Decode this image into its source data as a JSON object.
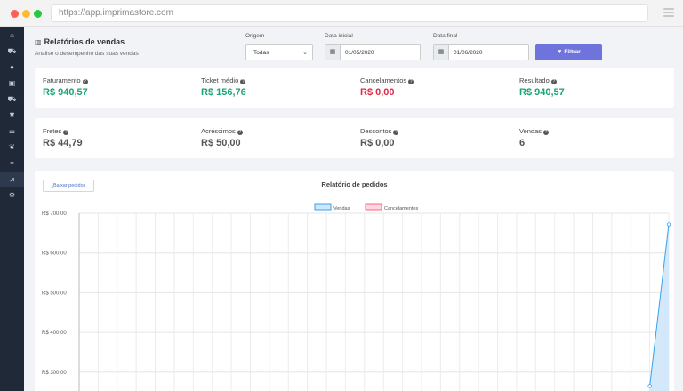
{
  "browser": {
    "url": "https://app.imprimastore.com"
  },
  "sidebar": {
    "items": [
      {
        "icon": "home-icon",
        "glyph": "⌂"
      },
      {
        "icon": "cart-icon",
        "glyph": "⛟"
      },
      {
        "icon": "user-icon",
        "glyph": "●"
      },
      {
        "icon": "box-icon",
        "glyph": "▣"
      },
      {
        "icon": "truck-icon",
        "glyph": "⛟"
      },
      {
        "icon": "tools-icon",
        "glyph": "✖"
      },
      {
        "icon": "sitemap-icon",
        "glyph": "⚏"
      },
      {
        "icon": "leaf-icon",
        "glyph": "❦"
      },
      {
        "icon": "plug-icon",
        "glyph": "ǂ"
      },
      {
        "icon": "chart-line-icon",
        "glyph": "⩘",
        "active": true
      },
      {
        "icon": "cogs-icon",
        "glyph": "⚙"
      }
    ]
  },
  "header": {
    "title": "Relatórios de vendas",
    "subtitle": "Analise o desempenho das suas vendas"
  },
  "filters": {
    "origem_label": "Origem",
    "origem_value": "Todas",
    "data_inicial_label": "Data inicial",
    "data_inicial_value": "01/05/2020",
    "data_final_label": "Data final",
    "data_final_value": "01/06/2020",
    "filter_button": "Filtrar"
  },
  "metrics_row1": [
    {
      "label": "Faturamento",
      "value": "R$ 940,57",
      "color": "#1aa37a"
    },
    {
      "label": "Ticket médio",
      "value": "R$ 156,76",
      "color": "#1aa37a"
    },
    {
      "label": "Cancelamentos",
      "value": "R$ 0,00",
      "color": "#dc2a4a"
    },
    {
      "label": "Resultado",
      "value": "R$ 940,57",
      "color": "#1aa37a"
    }
  ],
  "metrics_row2": [
    {
      "label": "Fretes",
      "value": "R$ 44,79"
    },
    {
      "label": "Acréscimos",
      "value": "R$ 50,00"
    },
    {
      "label": "Descontos",
      "value": "R$ 0,00"
    },
    {
      "label": "Vendas",
      "value": "6"
    }
  ],
  "chart_section": {
    "download_button": "Baixar pedidos",
    "title": "Relatório de pedidos"
  },
  "chart_data": {
    "type": "line",
    "title": "Relatório de pedidos",
    "legend_placement": "top-center",
    "ytick_labels": [
      "R$ 700,00",
      "R$ 600,00",
      "R$ 500,00",
      "R$ 400,00",
      "R$ 300,00"
    ],
    "ylim": [
      250,
      700
    ],
    "grid": true,
    "x_count": 32,
    "series": [
      {
        "name": "Vendas",
        "color": "#36a2eb",
        "fill": "#cfe6fb",
        "points": [
          {
            "x": 30,
            "y": 265
          },
          {
            "x": 31,
            "y": 672
          }
        ]
      },
      {
        "name": "Cancelamentos",
        "color": "#ff6384",
        "fill": "#ffd6df",
        "points": []
      }
    ]
  }
}
